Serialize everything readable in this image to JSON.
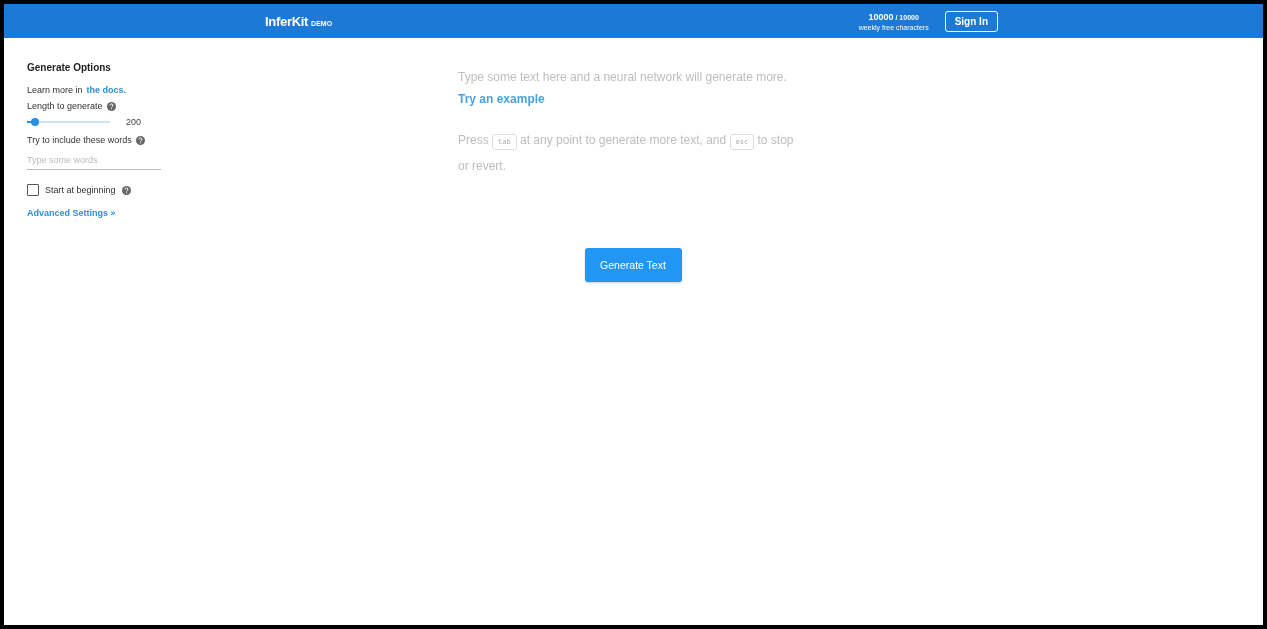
{
  "header": {
    "brand": "InferKit",
    "badge": "DEMO",
    "quota": {
      "used": "10000",
      "limit": "/ 10000",
      "caption": "weekly free characters"
    },
    "sign_in": "Sign In"
  },
  "sidebar": {
    "title": "Generate Options",
    "learn_more": {
      "text": "Learn more in",
      "link": "the docs."
    },
    "length": {
      "label": "Length to generate",
      "level": 0.1,
      "reading": "200"
    },
    "include_words": {
      "label": "Try to include these words",
      "placeholder": "Type some words"
    },
    "start_at_beginning": {
      "label": "Start at beginning",
      "checked": false
    },
    "advanced_link": "Advanced Settings »"
  },
  "editor": {
    "placeholder": "Type some text here and a neural network will generate more.",
    "example_link": "Try an example",
    "hint": [
      {
        "kind": "text",
        "text": "Press"
      },
      {
        "kind": "key",
        "text": "tab"
      },
      {
        "kind": "text",
        "text": "at any point to generate more text, and"
      },
      {
        "kind": "key",
        "text": "esc"
      },
      {
        "kind": "text",
        "text": "to stop"
      },
      {
        "kind": "text",
        "text": "or revert."
      }
    ]
  },
  "generate_button": "Generate Text"
}
